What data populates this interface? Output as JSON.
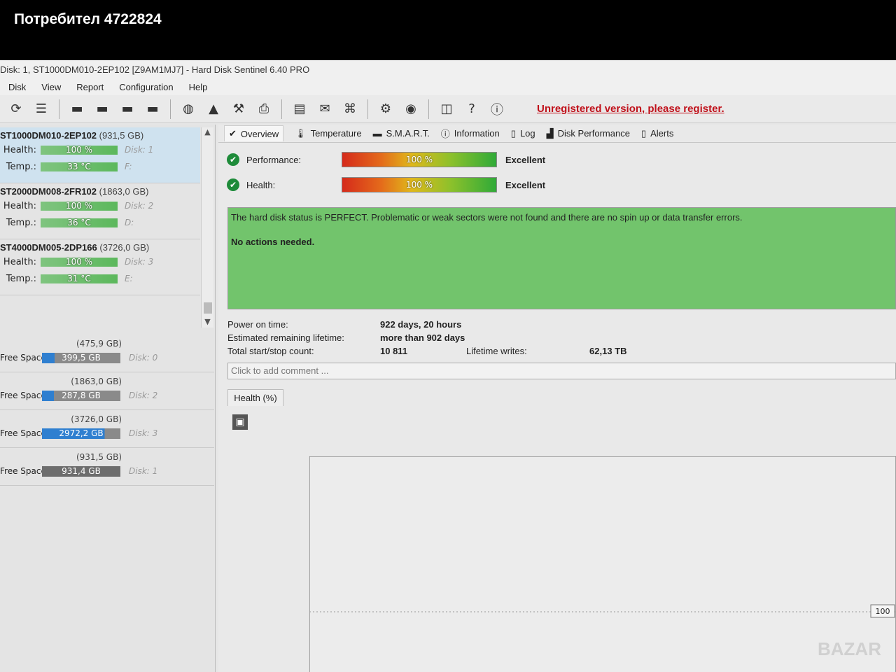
{
  "user_label": "Потребител 4722824",
  "window_title": "Disk: 1, ST1000DM010-2EP102 [Z9AM1MJ7] - Hard Disk Sentinel 6.40 PRO",
  "menu": [
    "Disk",
    "View",
    "Report",
    "Configuration",
    "Help"
  ],
  "unregistered_text": "Unregistered version, please register.",
  "disks": [
    {
      "name": "ST1000DM010-2EP102",
      "size": "(931,5 GB)",
      "health_label": "Health:",
      "health": "100 %",
      "disk": "Disk: 1",
      "temp_label": "Temp.:",
      "temp": "33 °C",
      "drive": "F:",
      "selected": true
    },
    {
      "name": "ST2000DM008-2FR102",
      "size": "(1863,0 GB)",
      "health_label": "Health:",
      "health": "100 %",
      "disk": "Disk: 2",
      "temp_label": "Temp.:",
      "temp": "36 °C",
      "drive": "D:",
      "selected": false
    },
    {
      "name": "ST4000DM005-2DP166",
      "size": "(3726,0 GB)",
      "health_label": "Health:",
      "health": "100 %",
      "disk": "Disk: 3",
      "temp_label": "Temp.:",
      "temp": "31 °C",
      "drive": "E:",
      "selected": false
    }
  ],
  "partitions": [
    {
      "size": "(475,9 GB)",
      "label": "Free Space",
      "free": "399,5 GB",
      "disk": "Disk: 0",
      "used_fraction": 0.84
    },
    {
      "size": "(1863,0 GB)",
      "label": "Free Space",
      "free": "287,8 GB",
      "disk": "Disk: 2",
      "used_fraction": 0.85
    },
    {
      "size": "(3726,0 GB)",
      "label": "Free Space",
      "free": "2972,2 GB",
      "disk": "Disk: 3",
      "used_fraction": 0.2
    },
    {
      "size": "(931,5 GB)",
      "label": "Free Space",
      "free": "931,4 GB",
      "disk": "Disk: 1",
      "used_fraction": 0.0
    }
  ],
  "tabs": [
    "Overview",
    "Temperature",
    "S.M.A.R.T.",
    "Information",
    "Log",
    "Disk Performance",
    "Alerts"
  ],
  "performance": {
    "label": "Performance:",
    "value": "100 %",
    "rating": "Excellent"
  },
  "health": {
    "label": "Health:",
    "value": "100 %",
    "rating": "Excellent"
  },
  "status_message": "The hard disk status is PERFECT. Problematic or weak sectors were not found and there are no spin up or data transfer errors.",
  "status_action": "No actions needed.",
  "info": {
    "power_on_label": "Power on time:",
    "power_on_value": "922 days, 20 hours",
    "lifetime_label": "Estimated remaining lifetime:",
    "lifetime_value": "more than 902 days",
    "startstop_label": "Total start/stop count:",
    "startstop_value": "10 811",
    "writes_label": "Lifetime writes:",
    "writes_value": "62,13 TB"
  },
  "comment_placeholder": "Click to add comment ...",
  "health_tab": "Health (%)",
  "chart_data": {
    "type": "line",
    "title": "",
    "xlabel": "",
    "ylabel": "100",
    "value_label": "100",
    "series": [
      {
        "values": [
          100
        ]
      }
    ]
  },
  "watermark": "BAZAR"
}
